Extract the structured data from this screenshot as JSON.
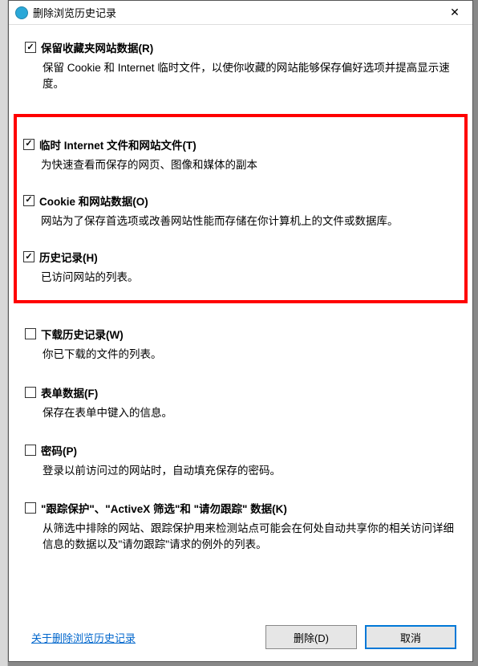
{
  "window": {
    "title": "删除浏览历史记录",
    "close_glyph": "✕"
  },
  "options": {
    "preserve_favorites": {
      "label": "保留收藏夹网站数据(R)",
      "desc": "保留 Cookie 和 Internet 临时文件，以使你收藏的网站能够保存偏好选项并提高显示速度。"
    },
    "temp_files": {
      "label": "临时 Internet 文件和网站文件(T)",
      "desc": "为快速查看而保存的网页、图像和媒体的副本"
    },
    "cookies": {
      "label": "Cookie 和网站数据(O)",
      "desc": "网站为了保存首选项或改善网站性能而存储在你计算机上的文件或数据库。"
    },
    "history": {
      "label": "历史记录(H)",
      "desc": "已访问网站的列表。"
    },
    "download_history": {
      "label": "下载历史记录(W)",
      "desc": "你已下载的文件的列表。"
    },
    "form_data": {
      "label": "表单数据(F)",
      "desc": "保存在表单中键入的信息。"
    },
    "passwords": {
      "label": "密码(P)",
      "desc": "登录以前访问过的网站时，自动填充保存的密码。"
    },
    "tracking": {
      "label": "\"跟踪保护\"、\"ActiveX 筛选\"和 \"请勿跟踪\" 数据(K)",
      "desc": "从筛选中排除的网站、跟踪保护用来检测站点可能会在何处自动共享你的相关访问详细信息的数据以及\"请勿跟踪\"请求的例外的列表。"
    }
  },
  "footer": {
    "about_link": "关于删除浏览历史记录",
    "delete_btn": "删除(D)",
    "cancel_btn": "取消"
  }
}
